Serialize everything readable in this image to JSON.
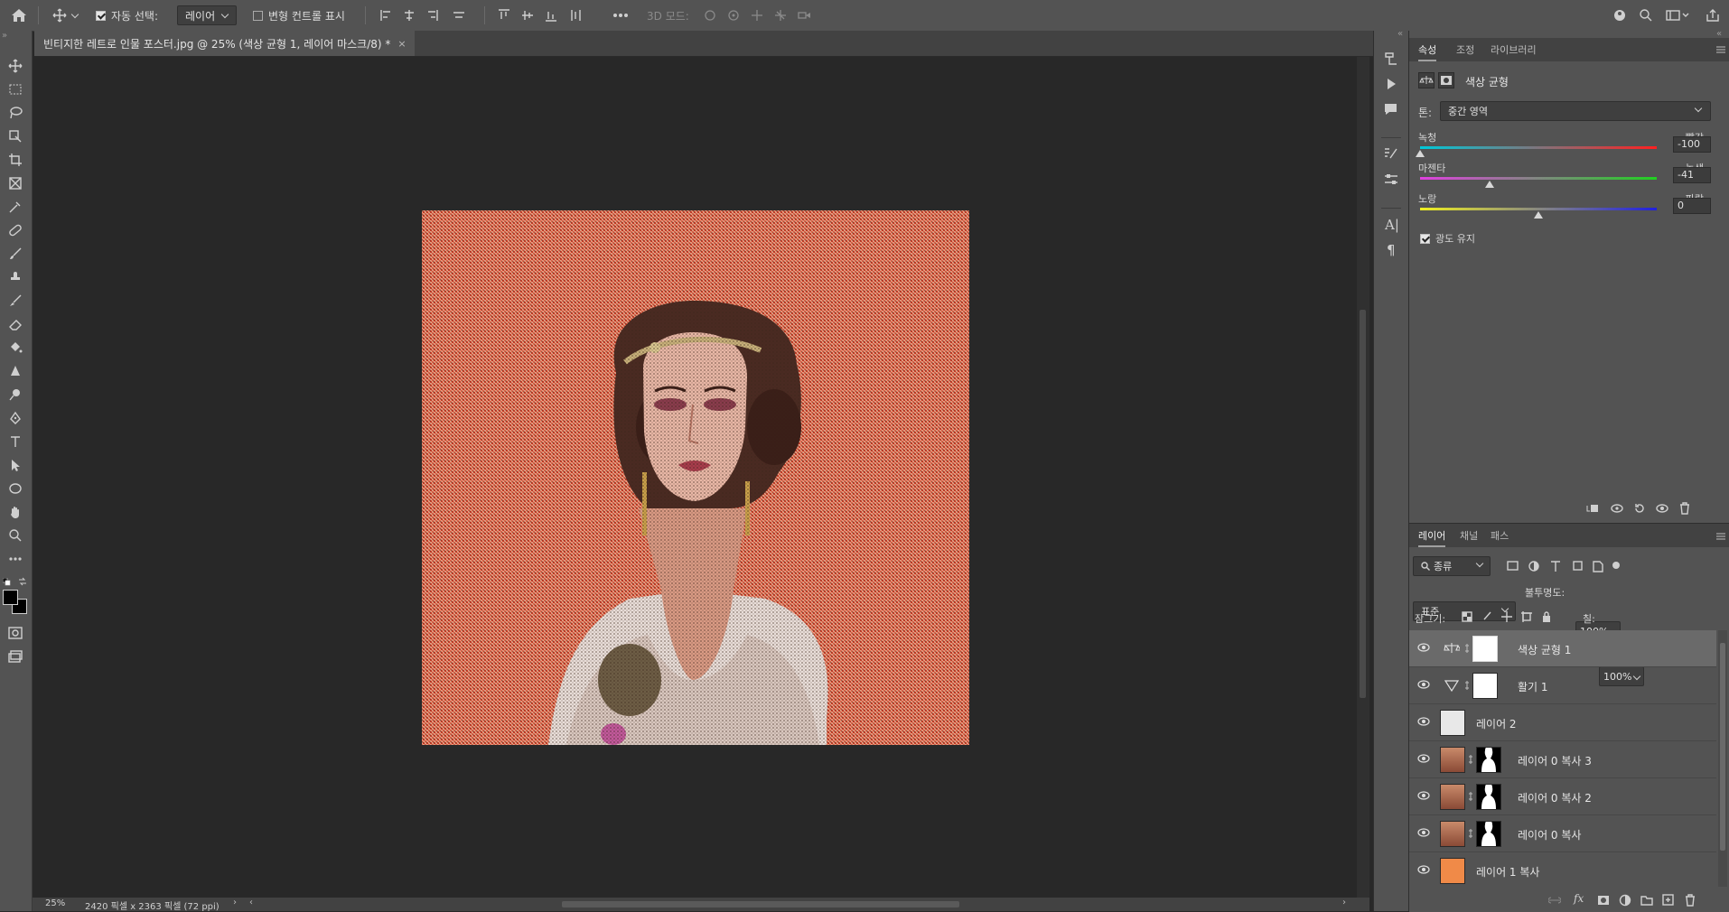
{
  "options_bar": {
    "auto_select_label": "자동 선택:",
    "auto_select_value": "레이어",
    "transform_controls_label": "변형 컨트롤 표시",
    "three_d_mode_label": "3D 모드:"
  },
  "document": {
    "tab_title": "빈티지한 레트로 인물 포스터.jpg @ 25% (색상 균형 1, 레이어 마스크/8) *",
    "zoom": "25%",
    "doc_info": "2420 픽셀 x 2363 픽셀 (72 ppi)"
  },
  "properties_panel": {
    "tabs": [
      "속성",
      "조정",
      "라이브러리"
    ],
    "adjustment_name": "색상 균형",
    "tone_label": "톤:",
    "tone_value": "중간 영역",
    "sliders": [
      {
        "left": "녹청",
        "right": "빨강",
        "value": "-100",
        "position": 0.0
      },
      {
        "left": "마젠타",
        "right": "녹색",
        "value": "-41",
        "position": 0.295
      },
      {
        "left": "노랑",
        "right": "파랑",
        "value": "0",
        "position": 0.5
      }
    ],
    "preserve_luminosity_label": "광도 유지"
  },
  "layers_panel": {
    "tabs": [
      "레이어",
      "채널",
      "패스"
    ],
    "filter_value": "종류",
    "blend_mode": "표준",
    "opacity_label": "불투명도:",
    "opacity_value": "100%",
    "lock_label": "잠그기:",
    "fill_label": "칠:",
    "fill_value": "100%",
    "layers": [
      {
        "name": "색상 균형 1",
        "selected": true
      },
      {
        "name": "활기 1",
        "selected": false
      },
      {
        "name": "레이어 2",
        "selected": false
      },
      {
        "name": "레이어 0 복사 3",
        "selected": false
      },
      {
        "name": "레이어 0 복사 2",
        "selected": false
      },
      {
        "name": "레이어 0 복사",
        "selected": false
      },
      {
        "name": "레이어 1 복사",
        "selected": false
      }
    ]
  }
}
